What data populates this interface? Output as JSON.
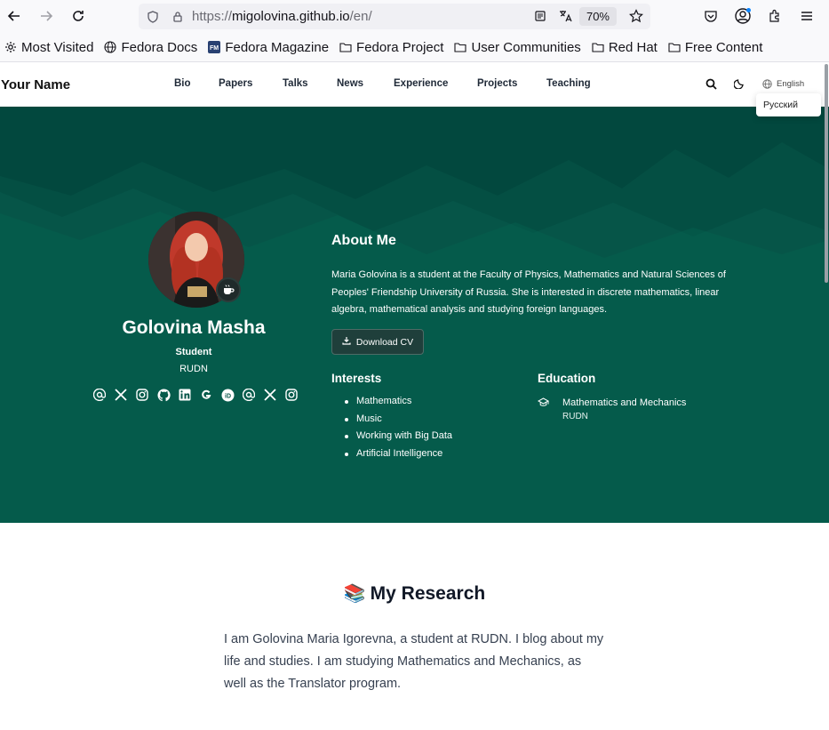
{
  "browser": {
    "url_scheme": "https://",
    "url_host": "migolovina.github.io",
    "url_path": "/en/",
    "zoom": "70%"
  },
  "bookmarks": [
    {
      "label": "Most Visited",
      "icon": "gear-icon"
    },
    {
      "label": "Fedora Docs",
      "icon": "globe-icon"
    },
    {
      "label": "Fedora Magazine",
      "icon": "fedora-magazine-icon"
    },
    {
      "label": "Fedora Project",
      "icon": "folder-icon"
    },
    {
      "label": "User Communities",
      "icon": "folder-icon"
    },
    {
      "label": "Red Hat",
      "icon": "folder-icon"
    },
    {
      "label": "Free Content",
      "icon": "folder-icon"
    }
  ],
  "site": {
    "brand": "Your Name",
    "nav": [
      "Bio",
      "Papers",
      "Talks",
      "News",
      "Experience",
      "Projects",
      "Teaching"
    ],
    "language": "English",
    "language_option": "Русский"
  },
  "profile": {
    "name": "Golovina Masha",
    "role": "Student",
    "organization": "RUDN"
  },
  "about": {
    "heading": "About Me",
    "text": "Maria Golovina is a student at the Faculty of Physics, Mathematics and Natural Sciences of Peoples' Friendship University of Russia. She is interested in discrete mathematics, linear algebra, mathematical analysis and studying foreign languages.",
    "cv_button": "Download CV"
  },
  "interests": {
    "heading": "Interests",
    "items": [
      "Mathematics",
      "Music",
      "Working with Big Data",
      "Artificial Intelligence"
    ]
  },
  "education": {
    "heading": "Education",
    "course": "Mathematics and Mechanics",
    "institution": "RUDN"
  },
  "research": {
    "emoji": "📚",
    "heading": "My Research",
    "text": "I am Golovina Maria Igorevna, a student at RUDN. I blog about my life and studies. I am studying Mathematics and Mechanics, as well as the Translator program."
  },
  "colors": {
    "hero_bg": "#065548",
    "hero_dark": "#04473c"
  }
}
